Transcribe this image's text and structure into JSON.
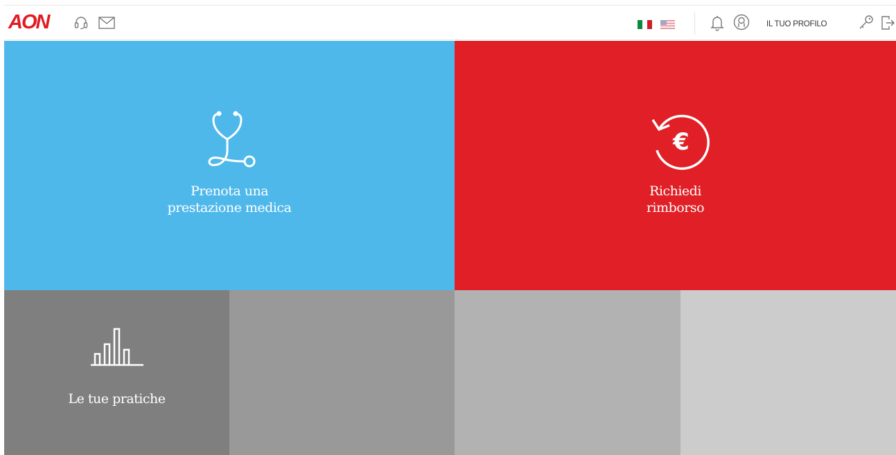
{
  "header": {
    "logo_text": "AON",
    "icons": {
      "support": "headset-icon",
      "messages": "mail-icon",
      "notifications": "bell-icon",
      "account": "user-circle-icon",
      "password": "key-icon",
      "logout": "logout-icon"
    },
    "languages": [
      "it",
      "en"
    ],
    "profile_label": "IL TUO PROFILO"
  },
  "tiles": [
    {
      "icon": "stethoscope-icon",
      "label_line1": "Prenota una",
      "label_line2": "prestazione medica",
      "color": "#4fb8eb"
    },
    {
      "icon": "euro-refund-icon",
      "label_line1": "Richiedi",
      "label_line2": "rimborso",
      "color": "#e02026"
    },
    {
      "icon": "bar-chart-icon",
      "label": "Le tue pratiche",
      "color": "#7f7f7f"
    }
  ],
  "colors": {
    "brand_red": "#e11b22",
    "tile_blue": "#4fb8eb",
    "tile_red": "#e02026",
    "gray_1": "#7f7f7f",
    "gray_2": "#999999",
    "gray_3": "#b2b2b2",
    "gray_4": "#cccccc"
  }
}
